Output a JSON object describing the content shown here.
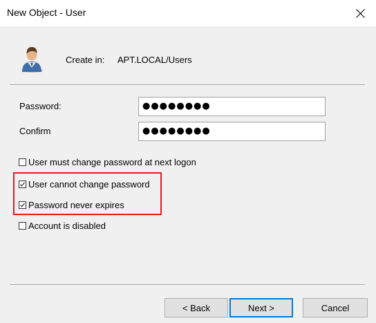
{
  "window": {
    "title": "New Object - User"
  },
  "header": {
    "create_in_label": "Create in:",
    "create_in_path": "APT.LOCAL/Users",
    "icon": "user-icon"
  },
  "form": {
    "password_label": "Password:",
    "password_value": "●●●●●●●●",
    "confirm_label": "Confirm",
    "confirm_value": "●●●●●●●●"
  },
  "options": [
    {
      "label": "User must change password at next logon",
      "checked": false
    },
    {
      "label": "User cannot change password",
      "checked": true
    },
    {
      "label": "Password never expires",
      "checked": true
    },
    {
      "label": "Account is disabled",
      "checked": false
    }
  ],
  "buttons": {
    "back": "< Back",
    "next": "Next >",
    "cancel": "Cancel"
  },
  "colors": {
    "highlight": "#e21a22",
    "dialog_bg": "#f0f0f0",
    "default_button_border": "#0078d7"
  }
}
